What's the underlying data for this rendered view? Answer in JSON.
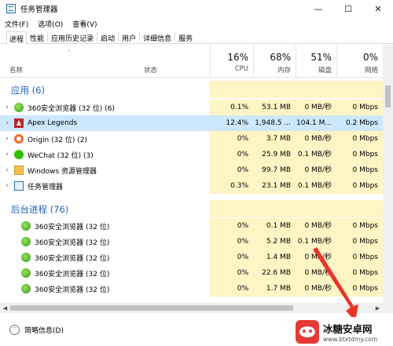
{
  "window": {
    "title": "任务管理器",
    "minimize": "—",
    "maximize": "☐",
    "close": "✕"
  },
  "menu": [
    "文件(F)",
    "选项(O)",
    "查看(V)"
  ],
  "tabs": [
    "进程",
    "性能",
    "应用历史记录",
    "启动",
    "用户",
    "详细信息",
    "服务"
  ],
  "active_tab": "进程",
  "columns": {
    "name": "名称",
    "status": "状态",
    "cpu": {
      "percent": "16%",
      "label": "CPU"
    },
    "memory": {
      "percent": "68%",
      "label": "内存"
    },
    "disk": {
      "percent": "51%",
      "label": "磁盘"
    },
    "network": {
      "percent": "0%",
      "label": "网络"
    }
  },
  "groups": {
    "apps": "应用 (6)",
    "background": "后台进程 (76)"
  },
  "apps": [
    {
      "name": "360安全浏览器 (32 位) (6)",
      "icon": "360-browser-icon",
      "cpu": "0.1%",
      "mem": "53.1 MB",
      "disk": "0 MB/秒",
      "net": "0 Mbps"
    },
    {
      "name": "Apex Legends",
      "icon": "apex-legends-icon",
      "cpu": "12.4%",
      "mem": "1,948.5 ...",
      "disk": "104.1 M...",
      "net": "0.2 Mbps",
      "selected": true
    },
    {
      "name": "Origin (32 位) (2)",
      "icon": "origin-icon",
      "cpu": "0%",
      "mem": "3.7 MB",
      "disk": "0 MB/秒",
      "net": "0 Mbps"
    },
    {
      "name": "WeChat (32 位) (3)",
      "icon": "wechat-icon",
      "cpu": "0%",
      "mem": "25.9 MB",
      "disk": "0.1 MB/秒",
      "net": "0 Mbps"
    },
    {
      "name": "Windows 资源管理器",
      "icon": "explorer-icon",
      "cpu": "0%",
      "mem": "99.7 MB",
      "disk": "0 MB/秒",
      "net": "0 Mbps"
    },
    {
      "name": "任务管理器",
      "icon": "task-manager-icon",
      "cpu": "0.3%",
      "mem": "23.1 MB",
      "disk": "0.1 MB/秒",
      "net": "0 Mbps"
    }
  ],
  "background": [
    {
      "name": "360安全浏览器 (32 位)",
      "cpu": "0%",
      "mem": "0.1 MB",
      "disk": "0 MB/秒",
      "net": "0 Mbps"
    },
    {
      "name": "360安全浏览器 (32 位)",
      "cpu": "0%",
      "mem": "5.2 MB",
      "disk": "0.1 MB/秒",
      "net": "0 Mbps"
    },
    {
      "name": "360安全浏览器 (32 位)",
      "cpu": "0%",
      "mem": "1.4 MB",
      "disk": "0 MB/秒",
      "net": "0 Mbps"
    },
    {
      "name": "360安全浏览器 (32 位)",
      "cpu": "0%",
      "mem": "22.6 MB",
      "disk": "0 MB/秒",
      "net": "0 Mbps"
    },
    {
      "name": "360安全浏览器 (32 位)",
      "cpu": "0%",
      "mem": "1.7 MB",
      "disk": "0 MB/秒",
      "net": "0 Mbps"
    }
  ],
  "footer": {
    "toggle_label": "简略信息(D)"
  },
  "watermark": {
    "name": "冰糖安卓网",
    "url": "www.btxtdmy.com"
  },
  "colors": {
    "accent": "#1e62b5",
    "heat": "#fff4c4",
    "selected": "#cce8ff",
    "arrow": "#e8352b"
  }
}
